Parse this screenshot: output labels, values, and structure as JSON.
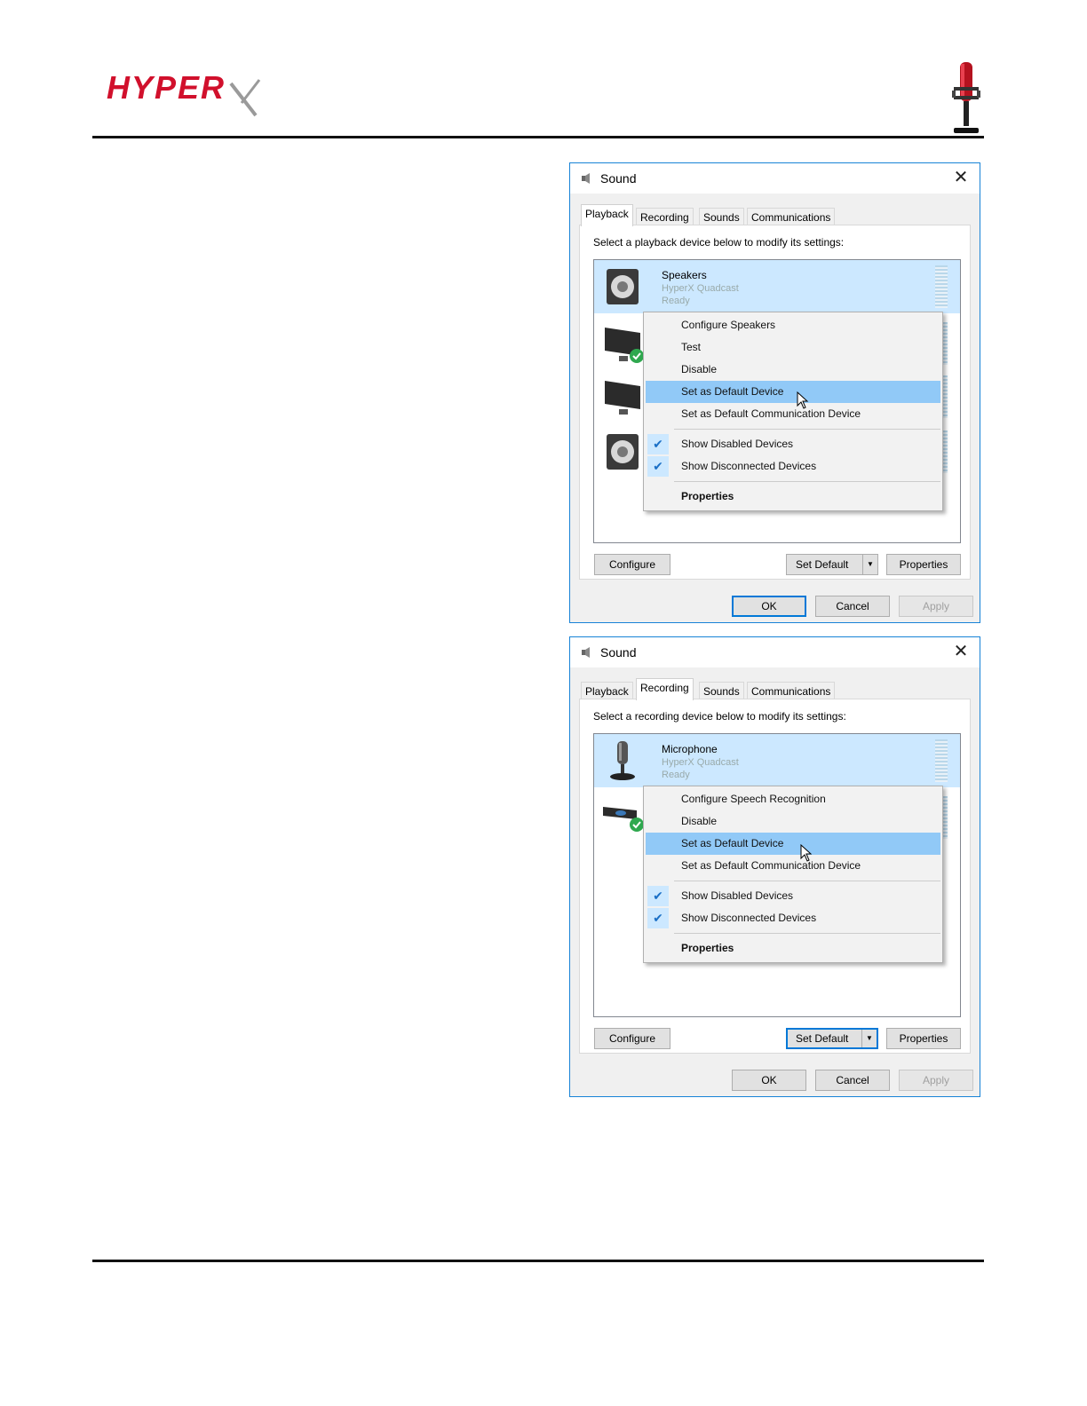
{
  "header": {
    "brand": "HYPER",
    "logo_icon": "hyperx-x-icon",
    "product_icon": "microphone-icon",
    "accent_color": "#d1102c"
  },
  "dialogs": [
    {
      "title": "Sound",
      "tabs": [
        "Playback",
        "Recording",
        "Sounds",
        "Communications"
      ],
      "active_tab": "Playback",
      "instruction": "Select a playback device below to modify its settings:",
      "selected_device": {
        "name": "Speakers",
        "detail": "HyperX Quadcast",
        "status": "Ready",
        "icon": "speaker-icon"
      },
      "other_device_icons": [
        "monitor-default-icon",
        "monitor-icon",
        "speaker-icon"
      ],
      "context_menu": {
        "items": [
          "Configure Speakers",
          "Test",
          "Disable",
          "Set as Default Device",
          "Set as Default Communication Device"
        ],
        "highlighted": "Set as Default Device",
        "checked_items": [
          "Show Disabled Devices",
          "Show Disconnected Devices"
        ],
        "properties": "Properties"
      },
      "buttons": {
        "configure": "Configure",
        "set_default": "Set Default",
        "properties": "Properties",
        "ok": "OK",
        "cancel": "Cancel",
        "apply": "Apply"
      }
    },
    {
      "title": "Sound",
      "tabs": [
        "Playback",
        "Recording",
        "Sounds",
        "Communications"
      ],
      "active_tab": "Recording",
      "instruction": "Select a recording device below to modify its settings:",
      "selected_device": {
        "name": "Microphone",
        "detail": "HyperX Quadcast",
        "status": "Ready",
        "icon": "microphone-icon"
      },
      "other_device_icons": [
        "webcam-default-icon"
      ],
      "context_menu": {
        "items": [
          "Configure Speech Recognition",
          "Disable",
          "Set as Default Device",
          "Set as Default Communication Device"
        ],
        "highlighted": "Set as Default Device",
        "checked_items": [
          "Show Disabled Devices",
          "Show Disconnected Devices"
        ],
        "properties": "Properties"
      },
      "buttons": {
        "configure": "Configure",
        "set_default": "Set Default",
        "properties": "Properties",
        "ok": "OK",
        "cancel": "Cancel",
        "apply": "Apply"
      }
    }
  ]
}
